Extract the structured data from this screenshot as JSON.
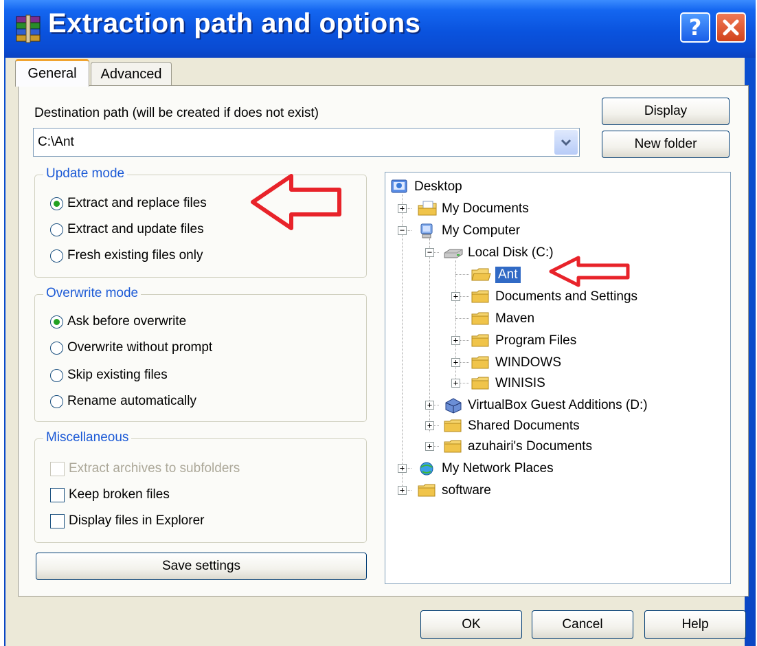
{
  "window": {
    "title": "Extraction path and options"
  },
  "tabs": [
    "General",
    "Advanced"
  ],
  "destination": {
    "label": "Destination path (will be created if does not exist)",
    "value": "C:\\Ant"
  },
  "buttons": {
    "display": "Display",
    "new_folder": "New folder",
    "save_settings": "Save settings",
    "ok": "OK",
    "cancel": "Cancel",
    "help": "Help"
  },
  "update_mode": {
    "title": "Update mode",
    "options": [
      "Extract and replace files",
      "Extract and update files",
      "Fresh existing files only"
    ],
    "selected": 0
  },
  "overwrite_mode": {
    "title": "Overwrite mode",
    "options": [
      "Ask before overwrite",
      "Overwrite without prompt",
      "Skip existing files",
      "Rename automatically"
    ],
    "selected": 0
  },
  "misc": {
    "title": "Miscellaneous",
    "options": [
      "Extract archives to subfolders",
      "Keep broken files",
      "Display files in Explorer"
    ]
  },
  "tree": {
    "items": [
      "Desktop",
      "My Documents",
      "My Computer",
      "Local Disk (C:)",
      "Ant",
      "Documents and Settings",
      "Maven",
      "Program Files",
      "WINDOWS",
      "WINISIS",
      "VirtualBox Guest Additions (D:)",
      "Shared Documents",
      "azuhairi's Documents",
      "My Network Places",
      "software"
    ],
    "selected": "Ant"
  },
  "colors": {
    "annotation_arrow": "#e8232a",
    "selection": "#316ac5",
    "group_legend": "#1c5ad6"
  }
}
